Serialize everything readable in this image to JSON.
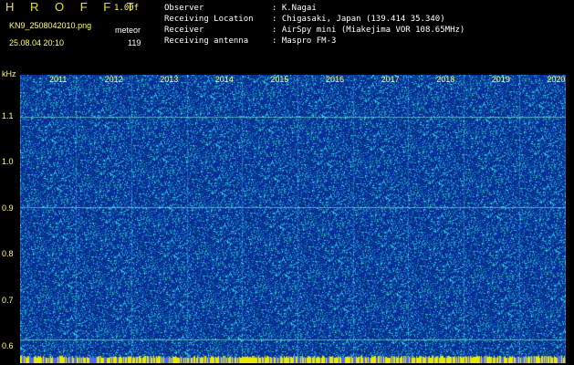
{
  "header": {
    "app_title": "H R O F F T",
    "version": "1.00f",
    "filename": "KN9_2508042010.png",
    "mode": "meteor",
    "datetime": "25.08.04 20:10",
    "count": "119"
  },
  "station": [
    {
      "label": "Observer",
      "value": ": K.Nagai"
    },
    {
      "label": "Receiving Location",
      "value": ": Chigasaki, Japan (139.414 35.340)"
    },
    {
      "label": "Receiver",
      "value": ": AirSpy mini (Miakejima VOR 108.65MHz)"
    },
    {
      "label": "Receiving antenna",
      "value": ": Maspro FM-3"
    }
  ],
  "colors": {
    "background": "#000000",
    "label": "#ffff66",
    "spectrogram_bg": "#0b2a96",
    "noise_light": "#3fd9d9",
    "baseline": "#e8e800"
  },
  "chart_data": {
    "type": "heatmap",
    "y_unit": "kHz",
    "yticks": [
      "1.1",
      "1.0",
      "0.9",
      "0.8",
      "0.7",
      "0.6"
    ],
    "xticks": [
      "2011",
      "2012",
      "2013",
      "2014",
      "2015",
      "2016",
      "2017",
      "2018",
      "2019",
      "2020"
    ],
    "ylim": [
      0.58,
      1.16
    ]
  }
}
